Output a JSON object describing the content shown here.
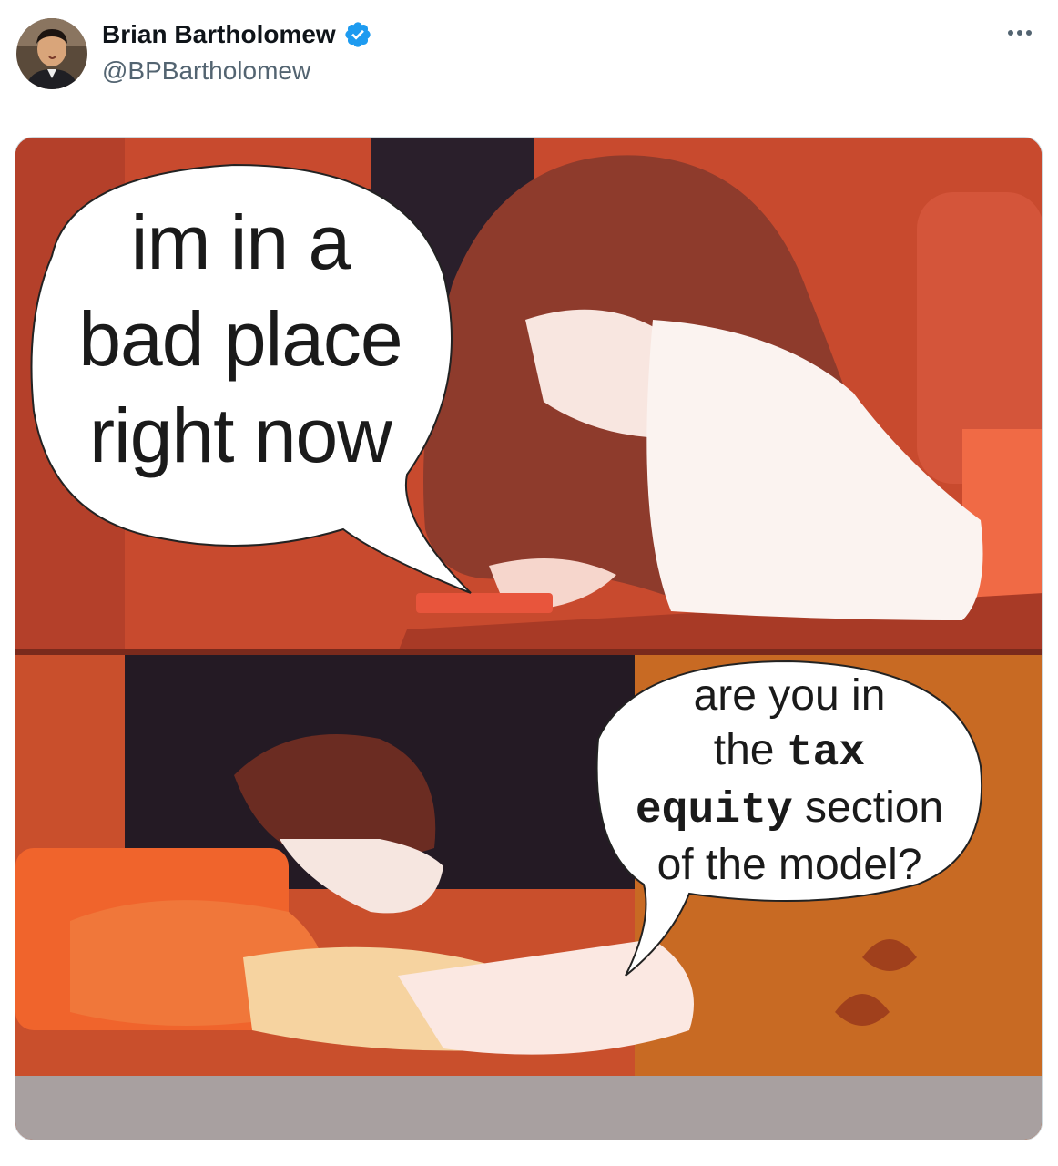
{
  "post": {
    "author_name": "Brian Bartholomew",
    "author_handle": "@BPBartholomew",
    "verified": true
  },
  "icons": {
    "verified": "verified-badge-icon",
    "more": "more-options-icon"
  },
  "colors": {
    "verified_blue": "#1d9bf0",
    "text_primary": "#0f1419",
    "text_secondary": "#536471"
  },
  "meme": {
    "top_bubble": [
      "im in a",
      "bad place",
      "right now"
    ],
    "bottom_bubble": {
      "line1": "are you in",
      "line2_plain": "the ",
      "line2_mono": "tax",
      "line3_mono": "equity",
      "line3_plain": " section",
      "line4": "of the model?"
    }
  }
}
